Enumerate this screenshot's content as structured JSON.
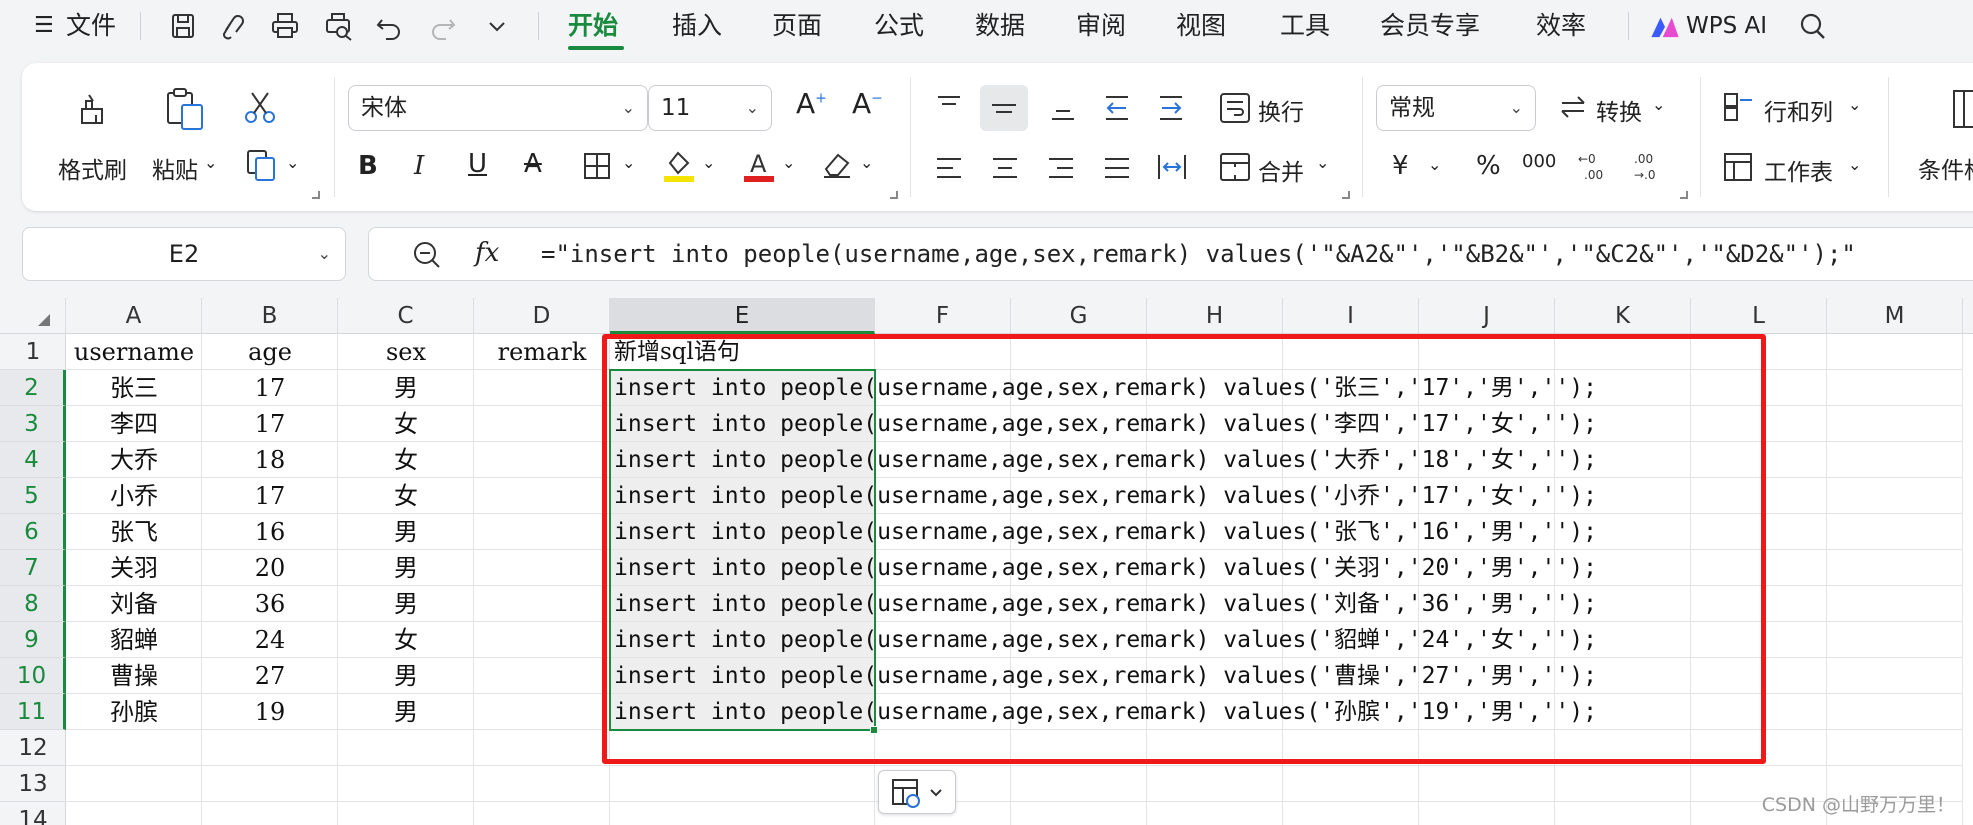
{
  "menubar": {
    "file_label": "文件",
    "tabs": [
      "开始",
      "插入",
      "页面",
      "公式",
      "数据",
      "审阅",
      "视图",
      "工具",
      "会员专享",
      "效率"
    ],
    "wps_ai": "WPS AI"
  },
  "ribbon": {
    "format_painter": "格式刷",
    "paste": "粘贴",
    "font_name": "宋体",
    "font_size": "11",
    "wrap": "换行",
    "merge": "合并",
    "number_format": "常规",
    "convert": "转换",
    "rows_cols": "行和列",
    "worksheet": "工作表",
    "conditional": "条件格",
    "percent": "%",
    "thousands": "000"
  },
  "formula_bar": {
    "name_box": "E2",
    "fx": "fx",
    "formula": "=\"insert into people(username,age,sex,remark) values('\"&A2&\"','\"&B2&\"','\"&C2&\"','\"&D2&\"');\""
  },
  "grid": {
    "columns": [
      "A",
      "B",
      "C",
      "D",
      "E",
      "F",
      "G",
      "H",
      "I",
      "J",
      "K",
      "L",
      "M"
    ],
    "rows": [
      "1",
      "2",
      "3",
      "4",
      "5",
      "6",
      "7",
      "8",
      "9",
      "10",
      "11",
      "12",
      "13",
      "14"
    ],
    "header": {
      "a": "username",
      "b": "age",
      "c": "sex",
      "d": "remark",
      "e": "新增sql语句"
    },
    "data": [
      {
        "name": "张三",
        "age": "17",
        "sex": "男",
        "sql": "insert into people(username,age,sex,remark) values('张三','17','男','');"
      },
      {
        "name": "李四",
        "age": "17",
        "sex": "女",
        "sql": "insert into people(username,age,sex,remark) values('李四','17','女','');"
      },
      {
        "name": "大乔",
        "age": "18",
        "sex": "女",
        "sql": "insert into people(username,age,sex,remark) values('大乔','18','女','');"
      },
      {
        "name": "小乔",
        "age": "17",
        "sex": "女",
        "sql": "insert into people(username,age,sex,remark) values('小乔','17','女','');"
      },
      {
        "name": "张飞",
        "age": "16",
        "sex": "男",
        "sql": "insert into people(username,age,sex,remark) values('张飞','16','男','');"
      },
      {
        "name": "关羽",
        "age": "20",
        "sex": "男",
        "sql": "insert into people(username,age,sex,remark) values('关羽','20','男','');"
      },
      {
        "name": "刘备",
        "age": "36",
        "sex": "男",
        "sql": "insert into people(username,age,sex,remark) values('刘备','36','男','');"
      },
      {
        "name": "貂蝉",
        "age": "24",
        "sex": "女",
        "sql": "insert into people(username,age,sex,remark) values('貂蝉','24','女','');"
      },
      {
        "name": "曹操",
        "age": "27",
        "sex": "男",
        "sql": "insert into people(username,age,sex,remark) values('曹操','27','男','');"
      },
      {
        "name": "孙膑",
        "age": "19",
        "sex": "男",
        "sql": "insert into people(username,age,sex,remark) values('孙膑','19','男','');"
      }
    ]
  },
  "watermark": "CSDN @山野万万里！",
  "colors": {
    "accent": "#1a8a3e",
    "highlight_box": "#f01818",
    "font_color_red": "#e02020",
    "fill_yellow": "#f5e400"
  }
}
